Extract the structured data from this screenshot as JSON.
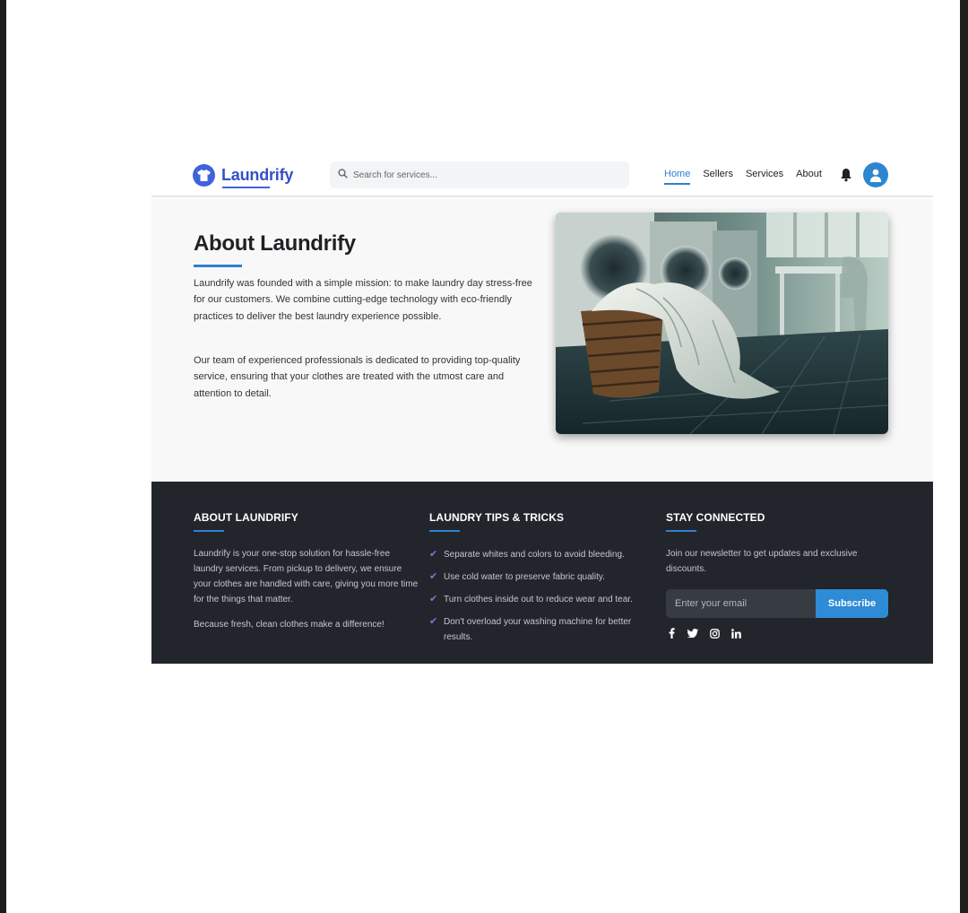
{
  "header": {
    "brand_name": "Laundrify",
    "search_placeholder": "Search for services...",
    "nav": [
      {
        "label": "Home",
        "active": true
      },
      {
        "label": "Sellers",
        "active": false
      },
      {
        "label": "Services",
        "active": false
      },
      {
        "label": "About",
        "active": false
      }
    ],
    "icons": [
      "shirt-icon",
      "search-icon",
      "bell-icon",
      "user-icon"
    ]
  },
  "about": {
    "title": "About Laundrify",
    "paragraph1": "Laundrify was founded with a simple mission: to make laundry day stress-free for our customers. We combine cutting-edge technology with eco-friendly practices to deliver the best laundry experience possible.",
    "paragraph2": "Our team of experienced professionals is dedicated to providing top-quality service, ensuring that your clothes are treated with the utmost care and attention to detail."
  },
  "footer": {
    "about_title": "ABOUT LAUNDRIFY",
    "about_text": "Laundrify is your one-stop solution for hassle-free laundry services. From pickup to delivery, we ensure your clothes are handled with care, giving you more time for the things that matter.",
    "about_tagline": "Because fresh, clean clothes make a difference!",
    "tips_title": "LAUNDRY TIPS & TRICKS",
    "tips": [
      "Separate whites and colors to avoid bleeding.",
      "Use cold water to preserve fabric quality.",
      "Turn clothes inside out to reduce wear and tear.",
      "Don't overload your washing machine for better results."
    ],
    "connect_title": "STAY CONNECTED",
    "connect_text": "Join our newsletter to get updates and exclusive discounts.",
    "email_placeholder": "Enter your email",
    "subscribe_label": "Subscribe",
    "social_icons": [
      "facebook-icon",
      "twitter-icon",
      "instagram-icon",
      "linkedin-icon"
    ]
  },
  "colors": {
    "brand": "#3f63dc",
    "accent": "#2f7fd0",
    "footer_bg": "#22252b",
    "check": "#8e6fd8"
  }
}
